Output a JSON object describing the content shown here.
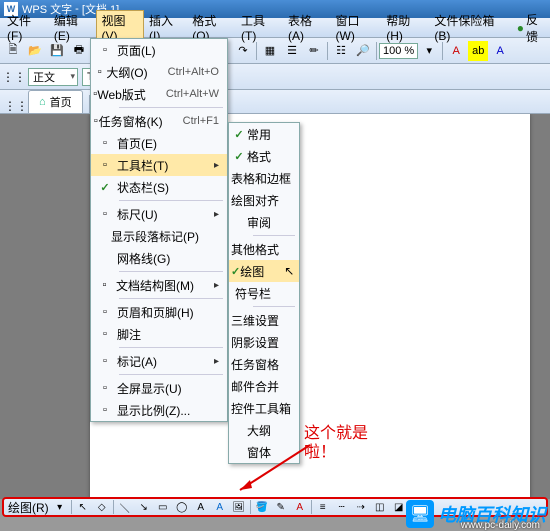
{
  "title": {
    "app": "WPS 文字",
    "doc": "[文档 1]"
  },
  "menus": {
    "items": [
      "文件(F)",
      "编辑(E)",
      "视图(V)",
      "插入(I)",
      "格式(O)",
      "工具(T)",
      "表格(A)",
      "窗口(W)",
      "帮助(H)",
      "文件保险箱(B)"
    ],
    "feedback": "反馈"
  },
  "toolbar": {
    "zoom": "100 %"
  },
  "format": {
    "style": "正文",
    "font": "Tim"
  },
  "tabs": {
    "main": "首页",
    "add": "+"
  },
  "viewMenu": {
    "items": [
      {
        "icon": "page-icon",
        "label": "页面(L)"
      },
      {
        "icon": "outline-icon",
        "label": "大纲(O)",
        "shortcut": "Ctrl+Alt+O"
      },
      {
        "icon": "web-icon",
        "label": "Web版式",
        "shortcut": "Ctrl+Alt+W"
      },
      {
        "sep": true
      },
      {
        "icon": "taskpane-icon",
        "label": "任务窗格(K)",
        "shortcut": "Ctrl+F1"
      },
      {
        "icon": "home-icon",
        "label": "首页(E)"
      },
      {
        "icon": "toolbar-icon",
        "label": "工具栏(T)",
        "arrow": true,
        "hl": true
      },
      {
        "icon": "check-icon",
        "label": "状态栏(S)",
        "check": true
      },
      {
        "sep": true
      },
      {
        "icon": "ruler-icon",
        "label": "标尺(U)",
        "arrow": true
      },
      {
        "icon": "",
        "label": "显示段落标记(P)"
      },
      {
        "icon": "",
        "label": "网格线(G)"
      },
      {
        "sep": true
      },
      {
        "icon": "docmap-icon",
        "label": "文档结构图(M)",
        "arrow": true
      },
      {
        "sep": true
      },
      {
        "icon": "header-icon",
        "label": "页眉和页脚(H)"
      },
      {
        "icon": "footnote-icon",
        "label": "脚注"
      },
      {
        "sep": true
      },
      {
        "icon": "mark-icon",
        "label": "标记(A)",
        "arrow": true
      },
      {
        "sep": true
      },
      {
        "icon": "fullscreen-icon",
        "label": "全屏显示(U)"
      },
      {
        "icon": "zoom-icon",
        "label": "显示比例(Z)..."
      }
    ]
  },
  "toolbarMenu": {
    "items": [
      {
        "label": "常用",
        "check": true
      },
      {
        "label": "格式",
        "check": true
      },
      {
        "label": "表格和边框"
      },
      {
        "label": "绘图对齐"
      },
      {
        "label": "审阅"
      },
      {
        "sep": true
      },
      {
        "label": "其他格式"
      },
      {
        "label": "绘图",
        "hl": true,
        "check": true,
        "cursor": true
      },
      {
        "label": "符号栏"
      },
      {
        "sep": true
      },
      {
        "label": "三维设置"
      },
      {
        "label": "阴影设置"
      },
      {
        "label": "任务窗格"
      },
      {
        "label": "邮件合并"
      },
      {
        "label": "控件工具箱"
      },
      {
        "label": "大纲"
      },
      {
        "label": "窗体"
      }
    ]
  },
  "annotation": {
    "line1": "这个就是",
    "line2": "啦！"
  },
  "bottom": {
    "label": "绘图(R)"
  },
  "watermark": {
    "text": "电脑百科知识",
    "url": "www.pc-daily.com"
  }
}
